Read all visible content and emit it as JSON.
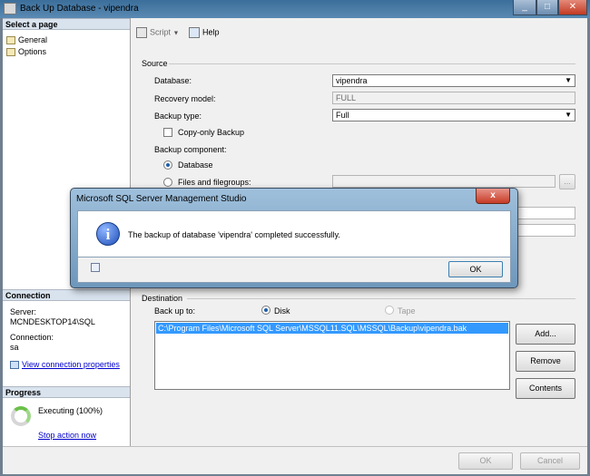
{
  "window": {
    "title": "Back Up Database - vipendra",
    "min": "_",
    "max": "□",
    "close": "✕"
  },
  "left": {
    "select_page_header": "Select a page",
    "pages": [
      {
        "label": "General"
      },
      {
        "label": "Options"
      }
    ],
    "connection_header": "Connection",
    "server_label": "Server:",
    "server_value": "MCNDESKTOP14\\SQL",
    "connection_label": "Connection:",
    "connection_value": "sa",
    "view_props_link": "View connection properties",
    "progress_header": "Progress",
    "executing": "Executing (100%)",
    "stop_link": "Stop action now",
    "progress_percent": 100
  },
  "toolbar": {
    "script_label": "Script",
    "help_label": "Help"
  },
  "source": {
    "group_label": "Source",
    "database_label": "Database:",
    "database_value": "vipendra",
    "recovery_label": "Recovery model:",
    "recovery_value": "FULL",
    "backup_type_label": "Backup type:",
    "backup_type_value": "Full",
    "copy_only_label": "Copy-only Backup",
    "copy_only_checked": false,
    "component_label": "Backup component:",
    "database_radio": "Database",
    "files_radio": "Files and filegroups:",
    "files_browse": "..."
  },
  "destination": {
    "group_label": "Destination",
    "back_up_to_label": "Back up to:",
    "disk_label": "Disk",
    "tape_label": "Tape",
    "path": "C:\\Program Files\\Microsoft SQL Server\\MSSQL11.SQL\\MSSQL\\Backup\\vipendra.bak",
    "add_button": "Add...",
    "remove_button": "Remove",
    "contents_button": "Contents"
  },
  "footer": {
    "ok_button": "OK",
    "cancel_button": "Cancel"
  },
  "dialog": {
    "title": "Microsoft SQL Server Management Studio",
    "message": "The backup of database 'vipendra' completed successfully.",
    "ok_button": "OK",
    "close": "x"
  },
  "colors": {
    "selection": "#3399ff",
    "link": "#0000cc",
    "progress": "#6cc04a"
  }
}
